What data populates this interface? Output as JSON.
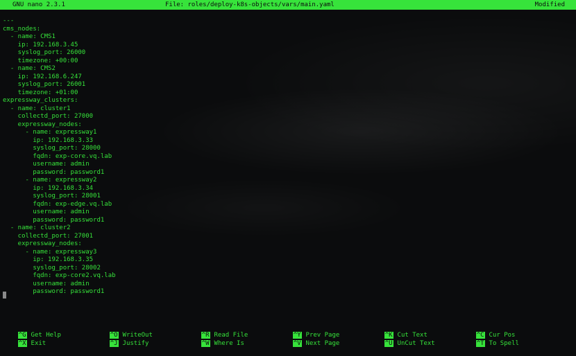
{
  "titlebar": {
    "app": "GNU nano 2.3.1",
    "file": "File: roles/deploy-k8s-objects/vars/main.yaml",
    "status": "Modified"
  },
  "editor": {
    "lines": [
      "---",
      "cms_nodes:",
      "  - name: CMS1",
      "    ip: 192.168.3.45",
      "    syslog_port: 26000",
      "    timezone: +00:00",
      "  - name: CMS2",
      "    ip: 192.168.6.247",
      "    syslog_port: 26001",
      "    timezone: +01:00",
      "expressway_clusters:",
      "  - name: cluster1",
      "    collectd_port: 27000",
      "    expressway_nodes:",
      "      - name: expressway1",
      "        ip: 192.168.3.33",
      "        syslog_port: 28000",
      "        fqdn: exp-core.vq.lab",
      "        username: admin",
      "        password: password1",
      "      - name: expressway2",
      "        ip: 192.168.3.34",
      "        syslog_port: 28001",
      "        fqdn: exp-edge.vq.lab",
      "        username: admin",
      "        password: password1",
      "  - name: cluster2",
      "    collectd_port: 27001",
      "    expressway_nodes:",
      "      - name: expressway3",
      "        ip: 192.168.3.35",
      "        syslog_port: 28002",
      "        fqdn: exp-core2.vq.lab",
      "        username: admin",
      "        password: password1"
    ]
  },
  "shortcuts": [
    {
      "key": "^G",
      "label": "Get Help"
    },
    {
      "key": "^O",
      "label": "WriteOut"
    },
    {
      "key": "^R",
      "label": "Read File"
    },
    {
      "key": "^Y",
      "label": "Prev Page"
    },
    {
      "key": "^K",
      "label": "Cut Text"
    },
    {
      "key": "^C",
      "label": "Cur Pos"
    },
    {
      "key": "^X",
      "label": "Exit"
    },
    {
      "key": "^J",
      "label": "Justify"
    },
    {
      "key": "^W",
      "label": "Where Is"
    },
    {
      "key": "^V",
      "label": "Next Page"
    },
    {
      "key": "^U",
      "label": "UnCut Text"
    },
    {
      "key": "^T",
      "label": "To Spell"
    }
  ],
  "colors": {
    "foreground": "#36e23a",
    "background": "#0b0c0d",
    "cursor": "#8a8a8a"
  }
}
